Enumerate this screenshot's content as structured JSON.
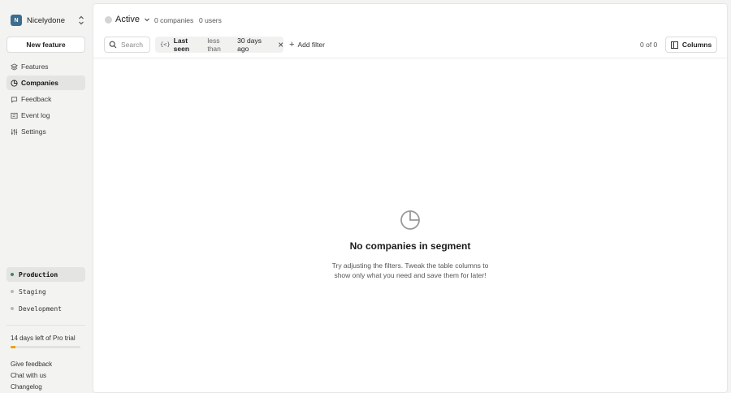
{
  "sidebar": {
    "org": {
      "initial": "N",
      "name": "Nicelydone"
    },
    "new_feature_label": "New feature",
    "nav": [
      {
        "label": "Features",
        "icon": "features-icon"
      },
      {
        "label": "Companies",
        "icon": "companies-icon",
        "active": true
      },
      {
        "label": "Feedback",
        "icon": "feedback-icon"
      },
      {
        "label": "Event log",
        "icon": "event-log-icon"
      },
      {
        "label": "Settings",
        "icon": "settings-icon"
      }
    ],
    "environments": [
      {
        "label": "Production",
        "color": "#2f8f5b",
        "active": true
      },
      {
        "label": "Staging",
        "color": "#b8b8b8"
      },
      {
        "label": "Development",
        "color": "#b8b8b8"
      }
    ],
    "trial": {
      "text": "14 days left of Pro trial",
      "progress": 0.07,
      "color": "#e8a317"
    },
    "footer_links": [
      "Give feedback",
      "Chat with us",
      "Changelog"
    ]
  },
  "header": {
    "segment_name": "Active",
    "companies_count": "0 companies",
    "users_count": "0 users"
  },
  "toolbar": {
    "search_placeholder": "Search",
    "filter": {
      "icon_text": "{<}",
      "field": "Last seen",
      "operator": "less than",
      "value": "30 days ago"
    },
    "add_filter_label": "Add filter",
    "pagination": "0 of 0",
    "columns_label": "Columns"
  },
  "empty_state": {
    "icon": "pie-chart-icon",
    "title": "No companies in segment",
    "description": "Try adjusting the filters. Tweak the table columns to show only what you need and save them for later!"
  }
}
